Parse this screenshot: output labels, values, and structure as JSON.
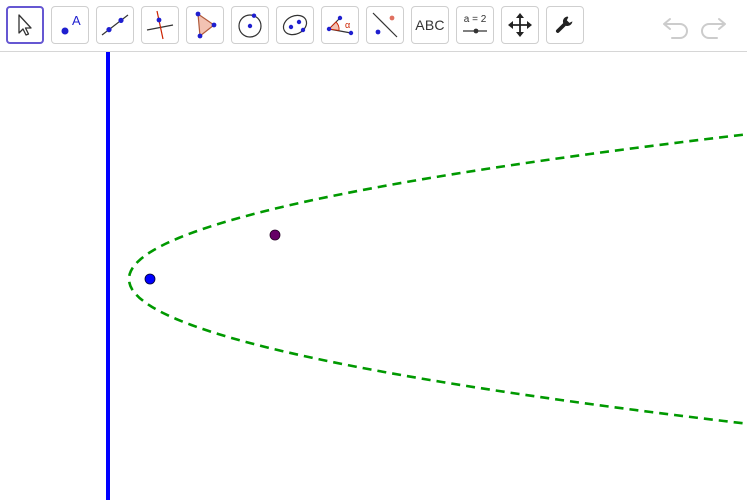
{
  "toolbar": {
    "tools": [
      {
        "id": "move",
        "icon": "move-arrow-icon",
        "selected": true
      },
      {
        "id": "point",
        "icon": "point-icon",
        "label": "A"
      },
      {
        "id": "line",
        "icon": "line-through-two-points-icon"
      },
      {
        "id": "perpendicular",
        "icon": "perpendicular-line-icon"
      },
      {
        "id": "polygon",
        "icon": "polygon-icon"
      },
      {
        "id": "circle-center",
        "icon": "circle-with-center-icon"
      },
      {
        "id": "ellipse",
        "icon": "ellipse-icon"
      },
      {
        "id": "angle",
        "icon": "angle-icon",
        "label": "α"
      },
      {
        "id": "reflect",
        "icon": "reflect-about-line-icon"
      },
      {
        "id": "text",
        "icon": "text-tool-icon",
        "label": "ABC"
      },
      {
        "id": "slider",
        "icon": "slider-icon",
        "label": "a = 2"
      },
      {
        "id": "move-graphics",
        "icon": "move-graphics-view-icon"
      },
      {
        "id": "settings",
        "icon": "wrench-icon"
      }
    ],
    "undo_icon": "undo-icon",
    "redo_icon": "redo-icon"
  },
  "canvas": {
    "objects": [
      {
        "type": "line",
        "name": "directrix",
        "color": "#0000ff",
        "style": "solid"
      },
      {
        "type": "conic",
        "name": "parabola",
        "color": "#009900",
        "style": "dashed"
      },
      {
        "type": "point",
        "name": "focus-point",
        "color": "#0000ff"
      },
      {
        "type": "point",
        "name": "free-point",
        "color": "#660066"
      }
    ]
  },
  "colors": {
    "accent": "#6557d2",
    "tool_blue": "#1f1fcf",
    "directrix": "#0000ff",
    "parabola": "#009900",
    "focus": "#0000ff",
    "free_point": "#660066",
    "disabled_icon": "#cccccc"
  }
}
